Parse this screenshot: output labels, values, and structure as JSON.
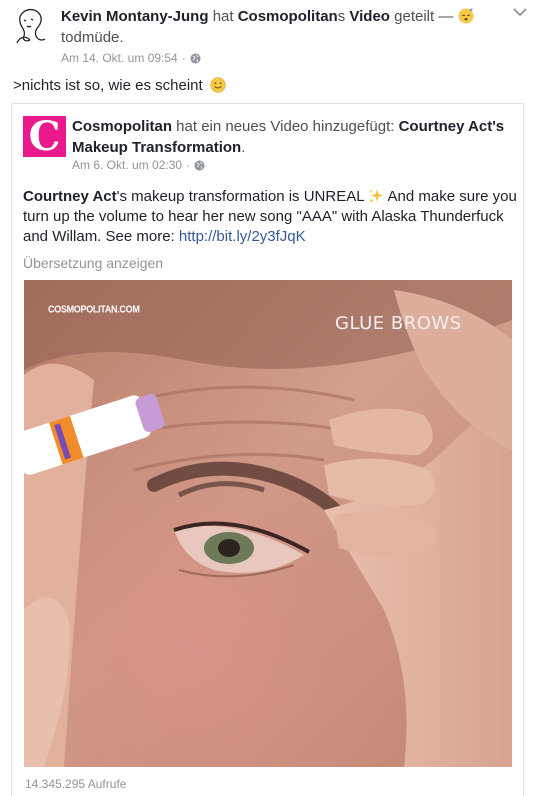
{
  "post": {
    "author": "Kevin Montany-Jung",
    "verb": "hat",
    "page_name": "Cosmopolitan",
    "possessive": "s",
    "object": "Video",
    "action": "geteilt —",
    "feeling_text": "todmüde.",
    "timestamp": "Am 14. Okt. um 09:54",
    "dot": "·",
    "text": ">nichts ist so, wie es scheint"
  },
  "shared": {
    "logo_letter": "C",
    "page_name": "Cosmopolitan",
    "action": "hat ein neues Video hinzugefügt:",
    "video_title": "Courtney Act's Makeup Transformation",
    "period": ".",
    "timestamp": "Am 6. Okt. um 02:30",
    "dot": "·",
    "body_bold": "Courtney Act",
    "body_1": "'s makeup transformation is UNREAL",
    "body_2": "And make sure you turn up the volume to hear her new song \"AAA\" with Alaska Thunderfuck and Willam. See more:",
    "link": "http://bit.ly/2y3fJqK",
    "translate_label": "Übersetzung anzeigen",
    "views": "14.345.295 Aufrufe"
  },
  "video": {
    "watermark": "COSMOPOLITAN.COM",
    "overlay_label": "GLUE BROWS"
  },
  "colors": {
    "brand": "#ea1a8c",
    "link": "#365899",
    "meta": "#90949c"
  },
  "icons": {
    "avatar": "sketch-avatar-icon",
    "caret": "chevron-down-icon",
    "globe": "globe-icon",
    "feeling": "sleepy-emoji-icon",
    "smiley": "smiley-emoji-icon",
    "sparkle": "sparkles-emoji-icon"
  }
}
